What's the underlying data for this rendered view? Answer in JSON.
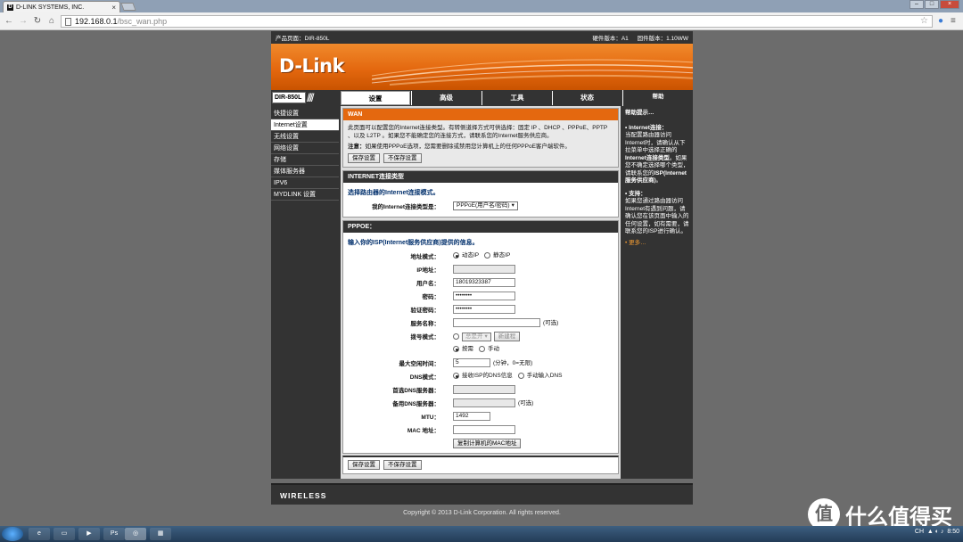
{
  "browser": {
    "tab_title": "D-LINK SYSTEMS, INC.",
    "url_host": "192.168.0.1",
    "url_path": "/bsc_wan.php"
  },
  "router": {
    "product_page": "产品页面：DIR-850L",
    "hw_version": "硬件版本：A1",
    "fw_version": "固件版本：1.10WW",
    "logo": "D-Link",
    "model": "DIR-850L",
    "tabs": [
      "设置",
      "高级",
      "工具",
      "状态",
      "帮助"
    ],
    "side_menu": [
      "快捷设置",
      "Internet设置",
      "无线设置",
      "网络设置",
      "存储",
      "媒体服务器",
      "IPV6",
      "MYDLINK 设置"
    ]
  },
  "wan": {
    "heading": "WAN",
    "desc": "此页面可以配置您的Internet连接类型。有转侧道择方式可供选择：固定 IP 、DHCP 、PPPoE、PPTP 、以及 L2TP 。如果您不能确定您的连接方式，请联系您的Internet服务供应商。",
    "note_label": "注意：",
    "note": "如果使用PPPoE选项，您需要删除或禁用您计算机上的任何PPPoE客户端软件。",
    "save": "保存设置",
    "nosave": "不保存设置"
  },
  "conn": {
    "heading": "INTERNET连接类型",
    "subtitle": "选择路由器的Internet连接模式。",
    "label": "我的Internet连接类型是：",
    "value": "PPPoE(用户名/密码)"
  },
  "pppoe": {
    "heading": "PPPOE：",
    "subtitle": "输入你的ISP(Internet服务供应商)提供的信息。",
    "addr_mode_label": "地址模式：",
    "dynamic_ip": "动态IP",
    "static_ip": "静态IP",
    "ip_label": "IP地址：",
    "ip_value": "",
    "user_label": "用户名：",
    "user_value": "18019323387",
    "pass_label": "密码：",
    "pass_value": "••••••••",
    "verify_label": "验证密码：",
    "verify_value": "••••••••",
    "service_label": "服务名称：",
    "service_value": "",
    "optional": "(可选)",
    "dial_label": "拨号模式：",
    "always_on": "总是开",
    "new_schedule": "新建程",
    "on_demand": "按需",
    "manual": "手动",
    "idle_label": "最大空闲时间：",
    "idle_value": "5",
    "idle_unit": "(分钟，0=无限)",
    "dns_label": "DNS模式：",
    "dns_isp": "接收ISP的DNS信息",
    "dns_manual": "手动输入DNS",
    "pdns_label": "首选DNS服务器：",
    "sdns_label": "备用DNS服务器：",
    "mtu_label": "MTU：",
    "mtu_value": "1492",
    "mac_label": "MAC 地址：",
    "mac_value": "",
    "clone_mac": "复制计算机的MAC地址"
  },
  "help": {
    "title": "帮助提示…",
    "sec1_title": "Internet连接：",
    "sec1_text": "当配置路由器访问Internet时，请确认从下拉菜单中选择正确的",
    "sec1_bold": "Internet连接类型",
    "sec1_text2": "。如果您不确定选择哪个类型，请联系您的",
    "sec1_bold2": "ISP(Internet 服务供应商)",
    "sec1_end": "。",
    "sec2_title": "支持：",
    "sec2_text": "如果您通过路由器访问Internet有遇到问题，请确认您在该页面中输入的任何设置，如有需要，请联系您的ISP进行确认。",
    "more": "更多…"
  },
  "footer": {
    "wireless": "WIRELESS",
    "copyright": "Copyright © 2013 D-Link Corporation. All rights reserved."
  },
  "watermark": {
    "icon": "值",
    "text": "什么值得买"
  },
  "taskbar": {
    "time": "8:50",
    "lang": "CH"
  }
}
